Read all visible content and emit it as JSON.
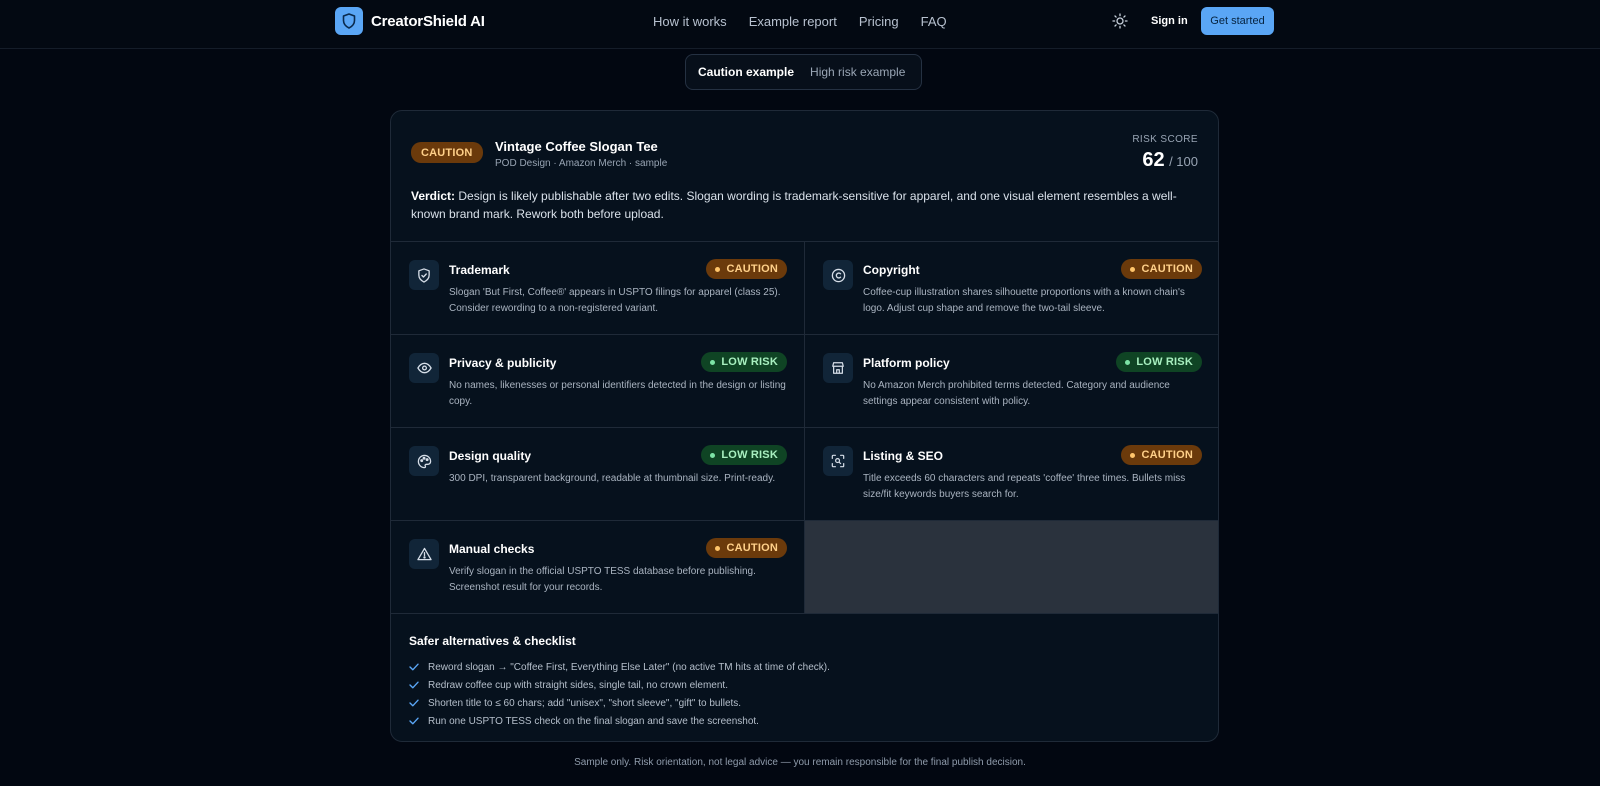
{
  "header": {
    "brand": "CreatorShield AI",
    "nav": [
      "How it works",
      "Example report",
      "Pricing",
      "FAQ"
    ],
    "sign_in": "Sign in",
    "get_started": "Get started"
  },
  "example_toggle": {
    "options": [
      "Caution example",
      "High risk example"
    ],
    "active": "Caution example"
  },
  "report": {
    "status_badge": "CAUTION",
    "product_title": "Vintage Coffee Slogan Tee",
    "product_meta": "POD Design · Amazon Merch · sample",
    "risk_label": "RISK SCORE",
    "risk_value": "62",
    "risk_max": "/ 100",
    "verdict_label": "Verdict:",
    "verdict_text": "Design is likely publishable after two edits. Slogan wording is trademark-sensitive for apparel, and one visual element resembles a well-known brand mark. Rework both before upload.",
    "checks": [
      {
        "title": "Trademark",
        "icon": "shield-icon",
        "badge": "CAUTION",
        "level": "caution",
        "desc": "Slogan 'But First, Coffee®' appears in USPTO filings for apparel (class 25). Consider rewording to a non-registered variant."
      },
      {
        "title": "Copyright",
        "icon": "copyright-icon",
        "badge": "CAUTION",
        "level": "caution",
        "desc": "Coffee-cup illustration shares silhouette proportions with a known chain's logo. Adjust cup shape and remove the two-tail sleeve."
      },
      {
        "title": "Privacy & publicity",
        "icon": "eye-icon",
        "badge": "LOW RISK",
        "level": "low",
        "desc": "No names, likenesses or personal identifiers detected in the design or listing copy."
      },
      {
        "title": "Platform policy",
        "icon": "store-icon",
        "badge": "LOW RISK",
        "level": "low",
        "desc": "No Amazon Merch prohibited terms detected. Category and audience settings appear consistent with policy."
      },
      {
        "title": "Design quality",
        "icon": "palette-icon",
        "badge": "LOW RISK",
        "level": "low",
        "desc": "300 DPI, transparent background, readable at thumbnail size. Print-ready."
      },
      {
        "title": "Listing & SEO",
        "icon": "scan-search-icon",
        "badge": "CAUTION",
        "level": "caution",
        "desc": "Title exceeds 60 characters and repeats 'coffee' three times. Bullets miss size/fit keywords buyers search for."
      },
      {
        "title": "Manual checks",
        "icon": "warning-icon",
        "badge": "CAUTION",
        "level": "caution",
        "desc": "Verify slogan in the official USPTO TESS database before publishing. Screenshot result for your records."
      }
    ],
    "checklist_title": "Safer alternatives & checklist",
    "checklist": [
      "Reword slogan → \"Coffee First, Everything Else Later\" (no active TM hits at time of check).",
      "Redraw coffee cup with straight sides, single tail, no crown element.",
      "Shorten title to ≤ 60 chars; add \"unisex\", \"short sleeve\", \"gift\" to bullets.",
      "Run one USPTO TESS check on the final slogan and save the screenshot."
    ]
  },
  "disclaimer": "Sample only. Risk orientation, not legal advice — you remain responsible for the final publish decision.",
  "colors": {
    "accent": "#5aa6f5",
    "caution_bg": "#6b3a0b",
    "caution_text": "#ffd089",
    "low_bg": "#0f4424",
    "low_text": "#a8f0c0"
  }
}
